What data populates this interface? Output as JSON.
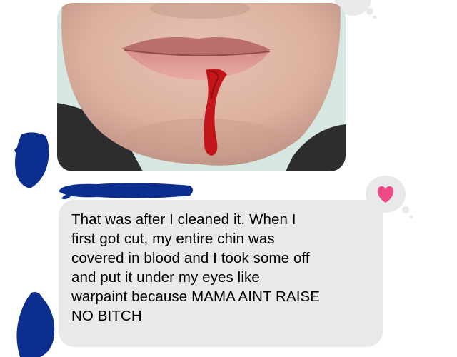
{
  "thread": {
    "messages": [
      {
        "type": "image",
        "sender": "other"
      },
      {
        "type": "text",
        "sender": "other",
        "text": "That was after I cleaned it. When I\nfirst got cut, my entire chin was\ncovered in blood and I took some off\nand put it under my eyes like\nwarpaint because MAMA AINT RAISE\nNO BITCH",
        "tapback": "heart-icon"
      }
    ]
  },
  "colors": {
    "bubble_gray": "#e9e9eb",
    "redaction_blue": "#0c2f8f",
    "heart_pink": "#ec4b85",
    "blood_red": "#c3161b"
  }
}
